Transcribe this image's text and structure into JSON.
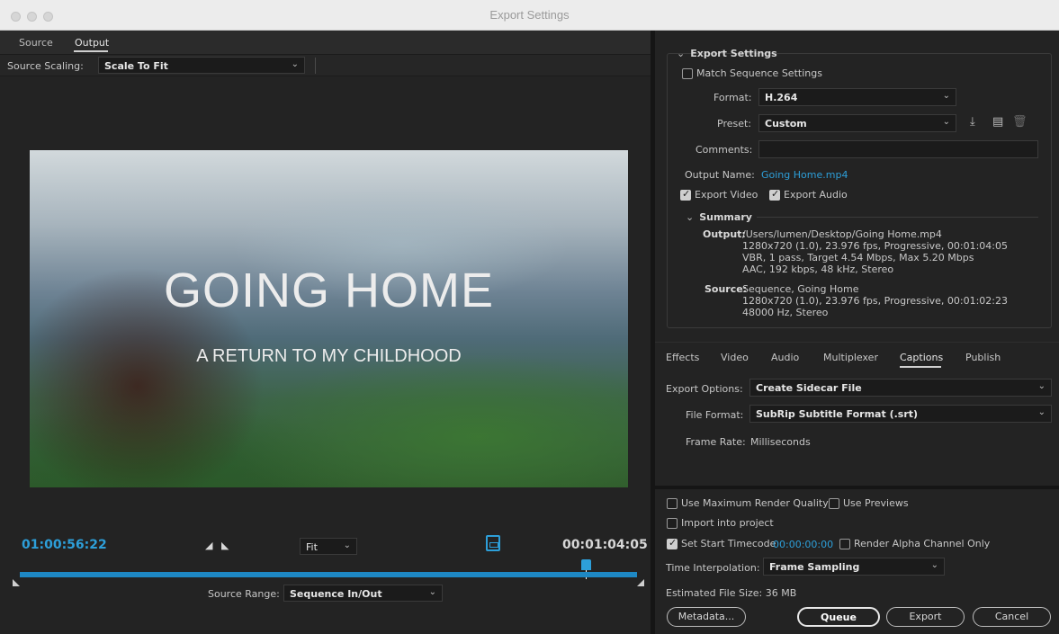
{
  "window": {
    "title": "Export Settings"
  },
  "left": {
    "tabs": [
      {
        "label": "Source"
      },
      {
        "label": "Output"
      }
    ],
    "source_scaling": {
      "label": "Source Scaling:",
      "value": "Scale To Fit"
    },
    "preview": {
      "title": "GOING HOME",
      "subtitle": "A RETURN TO MY CHILDHOOD"
    },
    "timecode_in": "01:00:56:22",
    "timecode_out": "00:01:04:05",
    "zoom": "Fit",
    "source_range": {
      "label": "Source Range:",
      "value": "Sequence In/Out"
    }
  },
  "export_settings": {
    "header": "Export Settings",
    "match_sequence": {
      "label": "Match Sequence Settings",
      "checked": false
    },
    "format": {
      "label": "Format:",
      "value": "H.264"
    },
    "preset": {
      "label": "Preset:",
      "value": "Custom"
    },
    "comments": {
      "label": "Comments:",
      "value": ""
    },
    "output_name": {
      "label": "Output Name:",
      "value": "Going Home.mp4"
    },
    "export_video": {
      "label": "Export Video",
      "checked": true
    },
    "export_audio": {
      "label": "Export Audio",
      "checked": true
    },
    "summary": {
      "header": "Summary",
      "output_label": "Output:",
      "output_lines": [
        "/Users/lumen/Desktop/Going Home.mp4",
        "1280x720 (1.0), 23.976 fps, Progressive, 00:01:04:05",
        "VBR, 1 pass, Target 4.54 Mbps, Max 5.20 Mbps",
        "AAC, 192 kbps, 48 kHz, Stereo"
      ],
      "source_label": "Source:",
      "source_lines": [
        "Sequence, Going Home",
        "1280x720 (1.0), 23.976 fps, Progressive, 00:01:02:23",
        "48000 Hz, Stereo"
      ]
    }
  },
  "settings_tabs": [
    {
      "label": "Effects"
    },
    {
      "label": "Video"
    },
    {
      "label": "Audio"
    },
    {
      "label": "Multiplexer"
    },
    {
      "label": "Captions"
    },
    {
      "label": "Publish"
    }
  ],
  "captions": {
    "export_options": {
      "label": "Export Options:",
      "value": "Create Sidecar File"
    },
    "file_format": {
      "label": "File Format:",
      "value": "SubRip Subtitle Format (.srt)"
    },
    "frame_rate": {
      "label": "Frame Rate:",
      "value": "Milliseconds"
    }
  },
  "bottom": {
    "max_render_quality": {
      "label": "Use Maximum Render Quality",
      "checked": false
    },
    "use_previews": {
      "label": "Use Previews",
      "checked": false
    },
    "import_project": {
      "label": "Import into project",
      "checked": false
    },
    "start_timecode": {
      "label": "Set Start Timecode",
      "checked": true,
      "value": "00:00:00:00"
    },
    "render_alpha": {
      "label": "Render Alpha Channel Only",
      "checked": false
    },
    "time_interpolation": {
      "label": "Time Interpolation:",
      "value": "Frame Sampling"
    },
    "estimated_size": "Estimated File Size:  36 MB",
    "buttons": {
      "metadata": "Metadata...",
      "queue": "Queue",
      "export": "Export",
      "cancel": "Cancel"
    }
  }
}
